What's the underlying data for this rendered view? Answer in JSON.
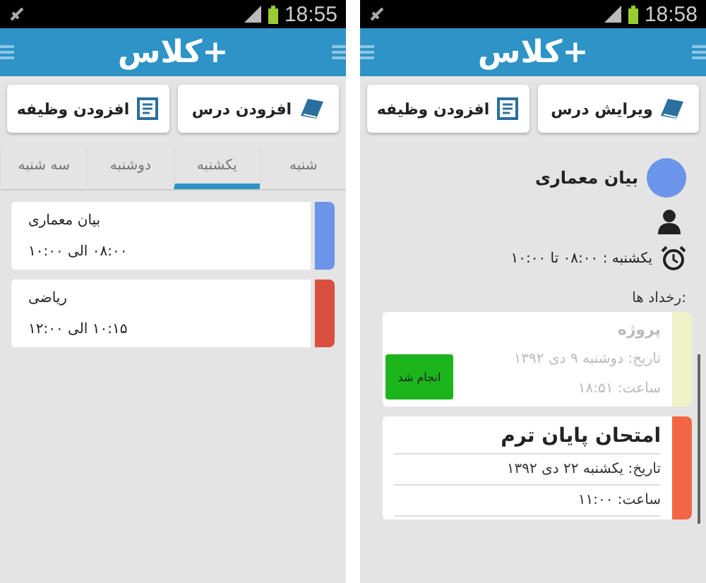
{
  "schedule_screen": {
    "status_time": "18:55",
    "logo": "کلاس+",
    "buttons": [
      {
        "label": "افزودن درس",
        "kind": "book"
      },
      {
        "label": "افزودن وظیفه",
        "kind": "task"
      }
    ],
    "tabs": [
      {
        "label": "شنبه",
        "selected": false
      },
      {
        "label": "یکشنبه",
        "selected": true
      },
      {
        "label": "دوشنبه",
        "selected": false
      },
      {
        "label": "سه شنبه",
        "selected": false
      }
    ],
    "classes": [
      {
        "name": "بیان معماری",
        "time": "۰۸:۰۰ الی ۱۰:۰۰",
        "color": "#6b95e8"
      },
      {
        "name": "ریاضی",
        "time": "۱۰:۱۵ الی ۱۲:۰۰",
        "color": "#d9503f"
      }
    ]
  },
  "detail_screen": {
    "status_time": "18:58",
    "logo": "کلاس+",
    "buttons": [
      {
        "label": "ویرایش درس",
        "kind": "book"
      },
      {
        "label": "افزودن وظیفه",
        "kind": "task"
      }
    ],
    "course": {
      "name": "بیان معماری",
      "color": "#6b95e8",
      "schedule": "یکشنبه : ۰۸:۰۰ تا ۱۰:۰۰"
    },
    "events_heading": "رخداد ها:",
    "events": [
      {
        "title": "پروژه",
        "date": "تاریخ: دوشنبه ۹ دی ۱۳۹۲",
        "time": "ساعت: ۱۸:۵۱",
        "color": "#eef3c8",
        "faded": true,
        "action": "انجام شد"
      },
      {
        "title": "امتحان پایان ترم",
        "date": "تاریخ: یکشنبه ۲۲ دی ۱۳۹۲",
        "time": "ساعت: ۱۱:۰۰",
        "color": "#f26644",
        "faded": false
      }
    ]
  }
}
